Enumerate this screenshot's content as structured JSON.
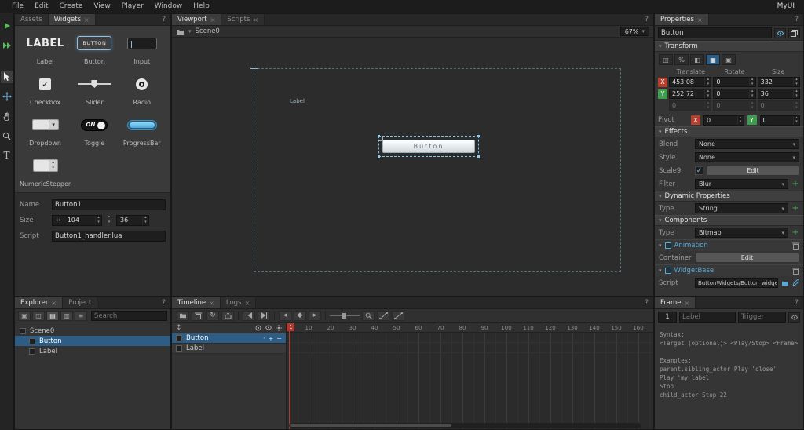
{
  "colors": {
    "accent_blue": "#4da4d9",
    "selection_blue": "#2d5c85",
    "axis_x_red": "#b5402f",
    "axis_y_green": "#3f9e4d",
    "playhead_red": "#b03a30",
    "progress_blue": "#58b7e8",
    "component_link_blue": "#58a8d8",
    "tool_green": "#5cb85c"
  },
  "icons": {
    "close": "×",
    "help": "?",
    "dropdown_arrow": "▾",
    "collapse_open": "▾",
    "stepper_up": "▴",
    "stepper_down": "▾",
    "plus": "+",
    "minus": "−",
    "dot": "·",
    "check": "✓",
    "resize_h": "↔",
    "updown": "↕",
    "loop": "↻",
    "key_prev": "◂",
    "key_add": "◆",
    "key_next": "▸",
    "text_tool": "T",
    "transform_tools": [
      "◫",
      "%",
      "◧",
      "▦",
      "▣"
    ],
    "explorer_tools": [
      "▣",
      "◫",
      "▤",
      "▥",
      "≡"
    ]
  },
  "menubar": {
    "items": [
      "File",
      "Edit",
      "Create",
      "View",
      "Player",
      "Window",
      "Help"
    ],
    "app_name": "MyUI"
  },
  "widgets_panel": {
    "tab_assets": "Assets",
    "tab_widgets": "Widgets",
    "items": [
      {
        "label": "Label",
        "preview_text": "LABEL"
      },
      {
        "label": "Button",
        "preview_text": "BUTTON"
      },
      {
        "label": "Input"
      },
      {
        "label": "Checkbox"
      },
      {
        "label": "Slider"
      },
      {
        "label": "Radio"
      },
      {
        "label": "Dropdown"
      },
      {
        "label": "Toggle",
        "preview_text": "ON"
      },
      {
        "label": "ProgressBar"
      },
      {
        "label": "NumericStepper"
      }
    ],
    "form": {
      "name_label": "Name",
      "name_value": "Button1",
      "size_label": "Size",
      "size_width": "104",
      "size_height": "36",
      "script_label": "Script",
      "script_value": "Button1_handler.lua"
    }
  },
  "viewport_panel": {
    "tab_viewport": "Viewport",
    "tab_scripts": "Scripts",
    "breadcrumb": "Scene0",
    "zoom": "67%",
    "canvas": {
      "label_widget_text": "Label",
      "button_widget_text": "Button"
    }
  },
  "properties_panel": {
    "tab": "Properties",
    "target_name": "Button",
    "transform": {
      "title": "Transform",
      "col_translate": "Translate",
      "col_rotate": "Rotate",
      "col_size": "Size",
      "x_axis": "X",
      "x_translate": "453.08",
      "x_rotate": "0",
      "x_size": "332",
      "y_axis": "Y",
      "y_translate": "252.72",
      "y_rotate": "0",
      "y_size": "36",
      "z_translate": "0",
      "z_rotate": "0",
      "z_size": "0",
      "pivot_label": "Pivot",
      "pivot_x_axis": "X",
      "pivot_x_value": "0",
      "pivot_y_axis": "Y",
      "pivot_y_value": "0"
    },
    "effects": {
      "title": "Effects",
      "blend_label": "Blend",
      "blend_value": "None",
      "style_label": "Style",
      "style_value": "None",
      "scale9_label": "Scale9",
      "scale9_checked": true,
      "scale9_button": "Edit",
      "filter_label": "Filter",
      "filter_value": "Blur"
    },
    "dynamic_properties": {
      "title": "Dynamic Properties",
      "type_label": "Type",
      "type_value": "String"
    },
    "components": {
      "title": "Components",
      "type_label": "Type",
      "type_value": "Bitmap",
      "animation_name": "Animation",
      "container_label": "Container",
      "container_button": "Edit",
      "widgetbase_name": "WidgetBase",
      "script_label": "Script",
      "script_value": "ButtonWidgets/Button_widget.lua"
    }
  },
  "explorer_panel": {
    "tab_explorer": "Explorer",
    "tab_project": "Project",
    "search_placeholder": "Search",
    "tree": [
      {
        "label": "Scene0"
      },
      {
        "label": "Button"
      },
      {
        "label": "Label"
      }
    ]
  },
  "timeline_panel": {
    "tab_timeline": "Timeline",
    "tab_logs": "Logs",
    "current_frame": "1",
    "ruler": [
      "10",
      "20",
      "30",
      "40",
      "50",
      "60",
      "70",
      "80",
      "90",
      "100",
      "110",
      "120",
      "130",
      "140",
      "150",
      "160"
    ],
    "tracks": [
      {
        "label": "Button"
      },
      {
        "label": "Label"
      }
    ]
  },
  "frame_panel": {
    "tab": "Frame",
    "frame_value": "1",
    "label_placeholder": "Label",
    "trigger_placeholder": "Trigger",
    "help_lines": {
      "line1": "Syntax:",
      "line2": "<Target (optional)> <Play/Stop> <Frame>",
      "line3": "",
      "line4": "Examples:",
      "line5": "parent.sibling_actor Play 'close'",
      "line6": "Play 'my_label'",
      "line7": "Stop",
      "line8": "child_actor Stop 22"
    }
  }
}
